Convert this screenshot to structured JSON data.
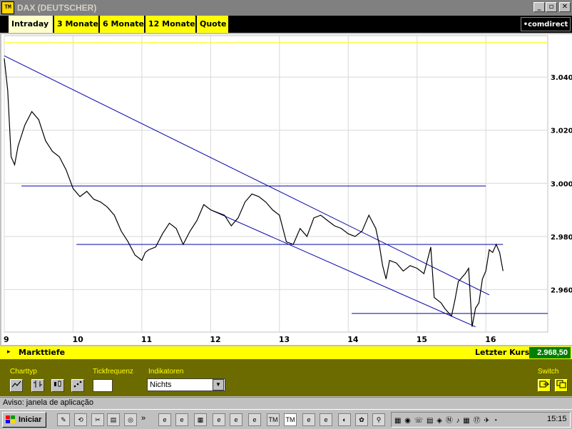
{
  "window": {
    "title": "DAX (DEUTSCHER)",
    "app_icon": "TM",
    "buttons": [
      "_",
      "▫",
      "✕"
    ]
  },
  "tabs": [
    {
      "label": "Intraday",
      "active": true
    },
    {
      "label": "3 Monate",
      "active": false
    },
    {
      "label": "6 Monate",
      "active": false
    },
    {
      "label": "12 Monate",
      "active": false
    },
    {
      "label": "Quote",
      "active": false
    }
  ],
  "brand": "•comdirect",
  "chart_data": {
    "type": "line",
    "x_ticks": [
      "9",
      "10",
      "11",
      "12",
      "13",
      "14",
      "15",
      "16"
    ],
    "y_ticks": [
      "3.040",
      "3.020",
      "3.000",
      "2.980",
      "2.960"
    ],
    "ylim": [
      2.944,
      3.054
    ],
    "grid": true,
    "colors": {
      "price": "#000000",
      "trend": "#0000aa",
      "ref": "#ffff00"
    },
    "series": [
      {
        "x": [
          9.0,
          9.05,
          9.1,
          9.15,
          9.2,
          9.3,
          9.4,
          9.5,
          9.6,
          9.7,
          9.8,
          9.9,
          10.0,
          10.1,
          10.2,
          10.3,
          10.4,
          10.5,
          10.6,
          10.7,
          10.8,
          10.9,
          11.0,
          11.05,
          11.1,
          11.2,
          11.3,
          11.4,
          11.5,
          11.6,
          11.7,
          11.8,
          11.9,
          12.0,
          12.1,
          12.2,
          12.3,
          12.4,
          12.5,
          12.6,
          12.7,
          12.8,
          12.9,
          13.0,
          13.1,
          13.2,
          13.3,
          13.4,
          13.5,
          13.6,
          13.7,
          13.8,
          13.9,
          14.0,
          14.1,
          14.2,
          14.3,
          14.4,
          14.45,
          14.5,
          14.55,
          14.6,
          14.7,
          14.8,
          14.9,
          15.0,
          15.1,
          15.2,
          15.25,
          15.3,
          15.35,
          15.4,
          15.5,
          15.55,
          15.6,
          15.7,
          15.75,
          15.8,
          15.85,
          15.9,
          15.95,
          16.0,
          16.05,
          16.1,
          16.15,
          16.2,
          16.25
        ],
        "y": [
          3.047,
          3.035,
          3.01,
          3.007,
          3.014,
          3.022,
          3.027,
          3.024,
          3.016,
          3.012,
          3.01,
          3.005,
          2.998,
          2.995,
          2.997,
          2.994,
          2.993,
          2.991,
          2.988,
          2.982,
          2.978,
          2.973,
          2.971,
          2.974,
          2.975,
          2.976,
          2.981,
          2.985,
          2.983,
          2.977,
          2.982,
          2.986,
          2.992,
          2.99,
          2.989,
          2.988,
          2.984,
          2.987,
          2.993,
          2.996,
          2.995,
          2.993,
          2.99,
          2.988,
          2.978,
          2.977,
          2.983,
          2.98,
          2.987,
          2.988,
          2.986,
          2.984,
          2.983,
          2.981,
          2.98,
          2.982,
          2.988,
          2.983,
          2.977,
          2.969,
          2.964,
          2.971,
          2.97,
          2.967,
          2.969,
          2.968,
          2.966,
          2.976,
          2.957,
          2.956,
          2.955,
          2.953,
          2.95,
          2.956,
          2.963,
          2.966,
          2.968,
          2.946,
          2.953,
          2.955,
          2.964,
          2.967,
          2.975,
          2.974,
          2.977,
          2.974,
          2.967
        ]
      }
    ],
    "trendlines": [
      {
        "x": [
          9.0,
          16.05
        ],
        "y": [
          3.048,
          2.958
        ]
      },
      {
        "x": [
          12.0,
          15.85
        ],
        "y": [
          2.99,
          2.946
        ]
      },
      {
        "x": [
          9.25,
          16.0
        ],
        "y": [
          2.999,
          2.999
        ]
      },
      {
        "x": [
          10.05,
          16.25
        ],
        "y": [
          2.977,
          2.977
        ]
      },
      {
        "x": [
          14.05,
          16.9
        ],
        "y": [
          2.951,
          2.951
        ]
      }
    ],
    "ref_line": {
      "y": 3.053
    }
  },
  "markttiefe": {
    "arrow": "▸",
    "label": "Markttiefe",
    "last_price_label": "Letzter Kurs",
    "last_price": "2.968,50"
  },
  "controls": {
    "charttyp_label": "Charttyp",
    "tickfrequenz_label": "Tickfrequenz",
    "indikatoren_label": "Indikatoren",
    "indikator_value": "Nichts",
    "switch_label": "Switch"
  },
  "status_text": "Aviso: janela de aplicação",
  "taskbar": {
    "start_label": "Iniciar",
    "clock": "15:15"
  }
}
